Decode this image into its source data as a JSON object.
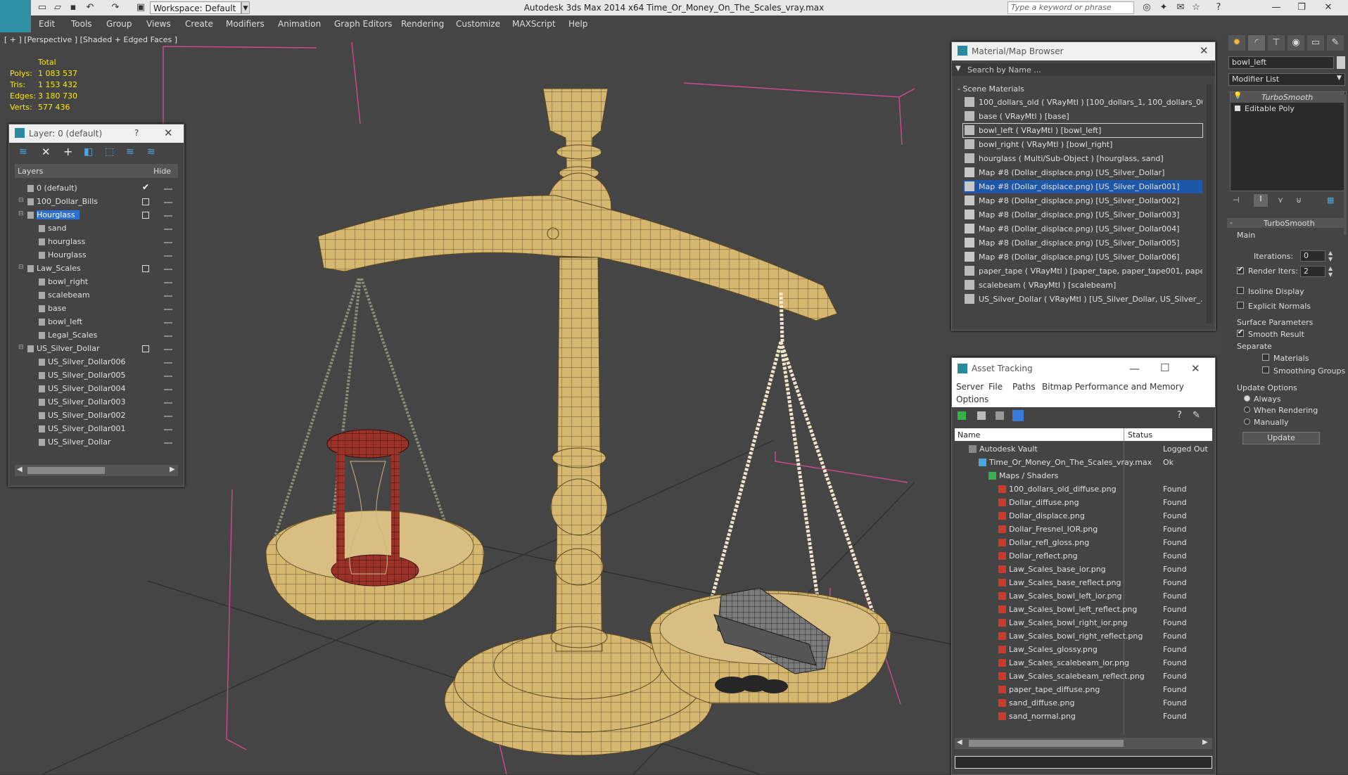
{
  "app": {
    "title": "Autodesk 3ds Max  2014 x64     Time_Or_Money_On_The_Scales_vray.max",
    "workspace_label": "Workspace: Default",
    "search_placeholder": "Type a keyword or phrase"
  },
  "menu": [
    "Edit",
    "Tools",
    "Group",
    "Views",
    "Create",
    "Modifiers",
    "Animation",
    "Graph Editors",
    "Rendering",
    "Customize",
    "MAXScript",
    "Help"
  ],
  "viewport": {
    "label": "[ + ] [Perspective ] [Shaded + Edged Faces ]",
    "stats": {
      "header": "Total",
      "polys_label": "Polys:",
      "polys": "1 083 537",
      "tris_label": "Tris:",
      "tris": "1 153 432",
      "edges_label": "Edges:",
      "edges": "3 180 730",
      "verts_label": "Verts:",
      "verts": "577 436"
    }
  },
  "layer_panel": {
    "title": "Layer: 0 (default)",
    "help": "?",
    "col_layers": "Layers",
    "col_hide": "Hide",
    "rows": [
      {
        "name": "0 (default)",
        "level": 0,
        "check": "tick"
      },
      {
        "name": "100_Dollar_Bills",
        "level": 0,
        "check": "box"
      },
      {
        "name": "Hourglass",
        "level": 0,
        "check": "box",
        "selected": true
      },
      {
        "name": "sand",
        "level": 1
      },
      {
        "name": "hourglass",
        "level": 1
      },
      {
        "name": "Hourglass",
        "level": 1
      },
      {
        "name": "Law_Scales",
        "level": 0,
        "check": "box"
      },
      {
        "name": "bowl_right",
        "level": 1
      },
      {
        "name": "scalebeam",
        "level": 1
      },
      {
        "name": "base",
        "level": 1
      },
      {
        "name": "bowl_left",
        "level": 1
      },
      {
        "name": "Legal_Scales",
        "level": 1
      },
      {
        "name": "US_Silver_Dollar",
        "level": 0,
        "check": "box"
      },
      {
        "name": "US_Silver_Dollar006",
        "level": 1
      },
      {
        "name": "US_Silver_Dollar005",
        "level": 1
      },
      {
        "name": "US_Silver_Dollar004",
        "level": 1
      },
      {
        "name": "US_Silver_Dollar003",
        "level": 1
      },
      {
        "name": "US_Silver_Dollar002",
        "level": 1
      },
      {
        "name": "US_Silver_Dollar001",
        "level": 1
      },
      {
        "name": "US_Silver_Dollar",
        "level": 1
      }
    ]
  },
  "material_browser": {
    "title": "Material/Map Browser",
    "search_placeholder": "Search by Name ...",
    "section": "- Scene Materials",
    "items": [
      {
        "label": "100_dollars_old  ( VRayMtl ) [100_dollars_1, 100_dollars_00...",
        "kind": "mtl"
      },
      {
        "label": "base  ( VRayMtl ) [base]",
        "kind": "mtl"
      },
      {
        "label": "bowl_left  ( VRayMtl ) [bowl_left]",
        "kind": "mtl",
        "boxed": true
      },
      {
        "label": "bowl_right  ( VRayMtl ) [bowl_right]",
        "kind": "mtl"
      },
      {
        "label": "hourglass  ( Multi/Sub-Object ) [hourglass, sand]",
        "kind": "mtl"
      },
      {
        "label": "Map #8 (Dollar_displace.png) [US_Silver_Dollar]",
        "kind": "map"
      },
      {
        "label": "Map #8 (Dollar_displace.png) [US_Silver_Dollar001]",
        "kind": "map",
        "selected": true
      },
      {
        "label": "Map #8 (Dollar_displace.png) [US_Silver_Dollar002]",
        "kind": "map"
      },
      {
        "label": "Map #8 (Dollar_displace.png) [US_Silver_Dollar003]",
        "kind": "map"
      },
      {
        "label": "Map #8 (Dollar_displace.png) [US_Silver_Dollar004]",
        "kind": "map"
      },
      {
        "label": "Map #8 (Dollar_displace.png) [US_Silver_Dollar005]",
        "kind": "map"
      },
      {
        "label": "Map #8 (Dollar_displace.png) [US_Silver_Dollar006]",
        "kind": "map"
      },
      {
        "label": "paper_tape  ( VRayMtl ) [paper_tape, paper_tape001, paper...",
        "kind": "mtl"
      },
      {
        "label": "scalebeam  ( VRayMtl ) [scalebeam]",
        "kind": "mtl"
      },
      {
        "label": "US_Silver_Dollar  ( VRayMtl ) [US_Silver_Dollar, US_Silver_...",
        "kind": "mtl"
      }
    ]
  },
  "asset_tracking": {
    "title": "Asset Tracking",
    "menu": [
      "Server",
      "File",
      "Paths",
      "Bitmap Performance and Memory",
      "Options"
    ],
    "col_name": "Name",
    "col_status": "Status",
    "rows": [
      {
        "name": "Autodesk Vault",
        "status": "Logged Out",
        "level": 1
      },
      {
        "name": "Time_Or_Money_On_The_Scales_vray.max",
        "status": "Ok",
        "level": 2
      },
      {
        "name": "Maps / Shaders",
        "status": "",
        "level": 3
      },
      {
        "name": "100_dollars_old_diffuse.png",
        "status": "Found",
        "level": 4
      },
      {
        "name": "Dollar_diffuse.png",
        "status": "Found",
        "level": 4
      },
      {
        "name": "Dollar_displace.png",
        "status": "Found",
        "level": 4
      },
      {
        "name": "Dollar_Fresnel_IOR.png",
        "status": "Found",
        "level": 4
      },
      {
        "name": "Dollar_refl_gloss.png",
        "status": "Found",
        "level": 4
      },
      {
        "name": "Dollar_reflect.png",
        "status": "Found",
        "level": 4
      },
      {
        "name": "Law_Scales_base_ior.png",
        "status": "Found",
        "level": 4
      },
      {
        "name": "Law_Scales_base_reflect.png",
        "status": "Found",
        "level": 4
      },
      {
        "name": "Law_Scales_bowl_left_ior.png",
        "status": "Found",
        "level": 4
      },
      {
        "name": "Law_Scales_bowl_left_reflect.png",
        "status": "Found",
        "level": 4
      },
      {
        "name": "Law_Scales_bowl_right_ior.png",
        "status": "Found",
        "level": 4
      },
      {
        "name": "Law_Scales_bowl_right_reflect.png",
        "status": "Found",
        "level": 4
      },
      {
        "name": "Law_Scales_glossy.png",
        "status": "Found",
        "level": 4
      },
      {
        "name": "Law_Scales_scalebeam_ior.png",
        "status": "Found",
        "level": 4
      },
      {
        "name": "Law_Scales_scalebeam_reflect.png",
        "status": "Found",
        "level": 4
      },
      {
        "name": "paper_tape_diffuse.png",
        "status": "Found",
        "level": 4
      },
      {
        "name": "sand_diffuse.png",
        "status": "Found",
        "level": 4
      },
      {
        "name": "sand_normal.png",
        "status": "Found",
        "level": 4
      }
    ]
  },
  "command_panel": {
    "object_name": "bowl_left",
    "modifier_list": "Modifier List",
    "stack": [
      {
        "label": "TurboSmooth",
        "active": true
      },
      {
        "label": "Editable Poly",
        "active": false
      }
    ],
    "rollout_title": "TurboSmooth",
    "main_label": "Main",
    "iterations_label": "Iterations:",
    "iterations_value": "0",
    "render_iters_label": "Render Iters:",
    "render_iters_value": "2",
    "render_iters_checked": true,
    "isoline_label": "Isoline Display",
    "explicit_normals_label": "Explicit Normals",
    "surface_params_label": "Surface Parameters",
    "smooth_result_label": "Smooth Result",
    "smooth_result_checked": true,
    "separate_label": "Separate",
    "materials_label": "Materials",
    "smoothing_groups_label": "Smoothing Groups",
    "update_options_label": "Update Options",
    "always_label": "Always",
    "when_rendering_label": "When Rendering",
    "manually_label": "Manually",
    "update_button": "Update",
    "selected_update_option": "Always"
  },
  "colors": {
    "accent": "#2e6fd6",
    "stats_text": "#ffe600",
    "wire_gold": "#d9b86a",
    "wire_red": "#8b2a22"
  }
}
